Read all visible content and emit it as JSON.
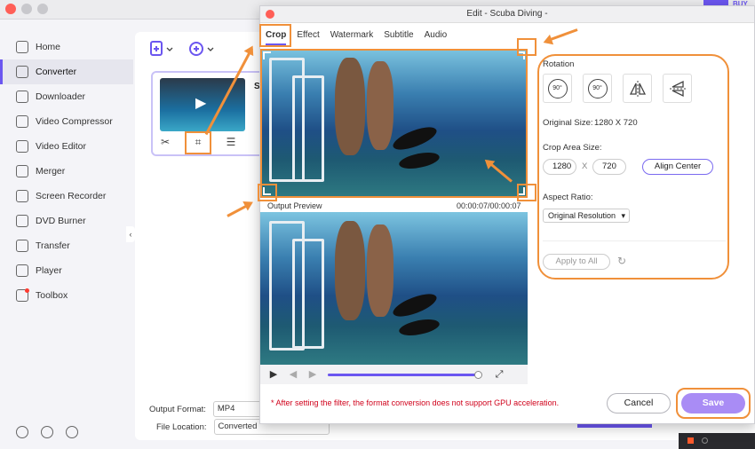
{
  "app": {
    "topright_tag_1": "",
    "topright_tag_2": "BUY N",
    "sidebar": {
      "items": [
        {
          "label": "Home",
          "icon": "home-icon"
        },
        {
          "label": "Converter",
          "icon": "converter-icon",
          "active": true
        },
        {
          "label": "Downloader",
          "icon": "downloader-icon"
        },
        {
          "label": "Video Compressor",
          "icon": "compress-icon"
        },
        {
          "label": "Video Editor",
          "icon": "editor-icon"
        },
        {
          "label": "Merger",
          "icon": "merger-icon"
        },
        {
          "label": "Screen Recorder",
          "icon": "recorder-icon"
        },
        {
          "label": "DVD Burner",
          "icon": "dvd-icon"
        },
        {
          "label": "Transfer",
          "icon": "transfer-icon"
        },
        {
          "label": "Player",
          "icon": "player-icon"
        },
        {
          "label": "Toolbox",
          "icon": "toolbox-icon"
        }
      ],
      "bottom_icons": [
        "help-icon",
        "bell-icon",
        "feedback-icon"
      ]
    },
    "file_card": {
      "title": "Sc"
    },
    "output_format_label": "Output Format:",
    "output_format_value": "MP4",
    "file_location_label": "File Location:",
    "file_location_value": "Converted"
  },
  "dialog": {
    "title": "Edit - Scuba Diving -",
    "tabs": [
      "Crop",
      "Effect",
      "Watermark",
      "Subtitle",
      "Audio"
    ],
    "output_preview_label": "Output Preview",
    "time_display": "00:00:07/00:00:07",
    "progress": 1.0,
    "rotation_label": "Rotation",
    "rotation_buttons": [
      "rotate-left-90-icon",
      "rotate-right-90-icon",
      "flip-horizontal-icon",
      "flip-vertical-icon"
    ],
    "rotate_left_text": "90°",
    "rotate_right_text": "90°",
    "original_size_label": "Original Size:",
    "original_size_value": "1280 X 720",
    "crop_area_label": "Crop Area Size:",
    "crop_width": "1280",
    "crop_x": "X",
    "crop_height": "720",
    "align_center": "Align Center",
    "aspect_ratio_label": "Aspect Ratio:",
    "aspect_ratio_value": "Original Resolution",
    "apply_to_all": "Apply to All",
    "warning": "* After setting the filter, the format conversion does not support GPU acceleration.",
    "cancel": "Cancel",
    "save": "Save"
  },
  "colors": {
    "accent": "#6b56f0",
    "annotation": "#f0903a",
    "warning": "#d0021b"
  }
}
